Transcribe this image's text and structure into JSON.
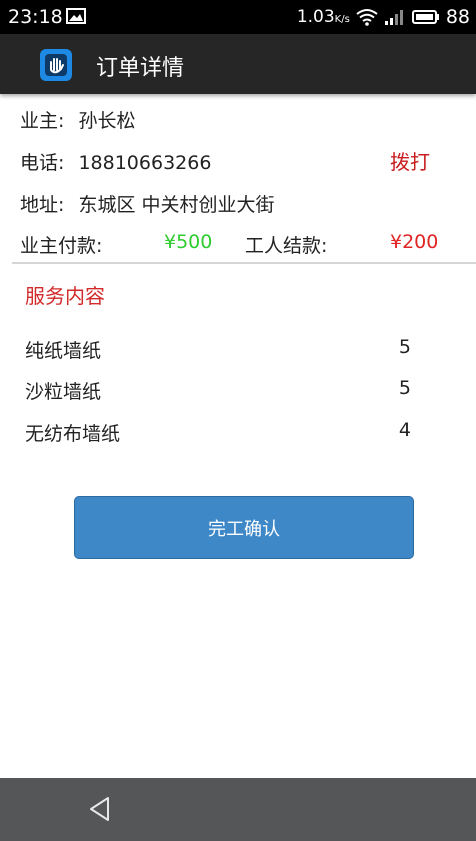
{
  "status_bar": {
    "time": "23:18",
    "speed": "1.03",
    "speed_unit": "K/s",
    "battery": "88"
  },
  "app_bar": {
    "title": "订单详情",
    "icon": "hand-logo-icon"
  },
  "order": {
    "owner_label": "业主:",
    "owner_value": "孙长松",
    "phone_label": "电话:",
    "phone_value": "18810663266",
    "call_label": "拨打",
    "address_label": "地址:",
    "address_value": "东城区 中关村创业大街",
    "owner_pay_label": "业主付款:",
    "owner_pay_value": "¥500",
    "worker_pay_label": "工人结款:",
    "worker_pay_value": "¥200"
  },
  "services": {
    "title": "服务内容",
    "items": [
      {
        "name": "纯纸墙纸",
        "qty": "5"
      },
      {
        "name": "沙粒墙纸",
        "qty": "5"
      },
      {
        "name": "无纺布墙纸",
        "qty": "4"
      }
    ]
  },
  "actions": {
    "confirm_label": "完工确认"
  },
  "colors": {
    "accent_red": "#d22a2a",
    "paid_green": "#2ecc2e",
    "button_blue": "#3e88c8"
  }
}
